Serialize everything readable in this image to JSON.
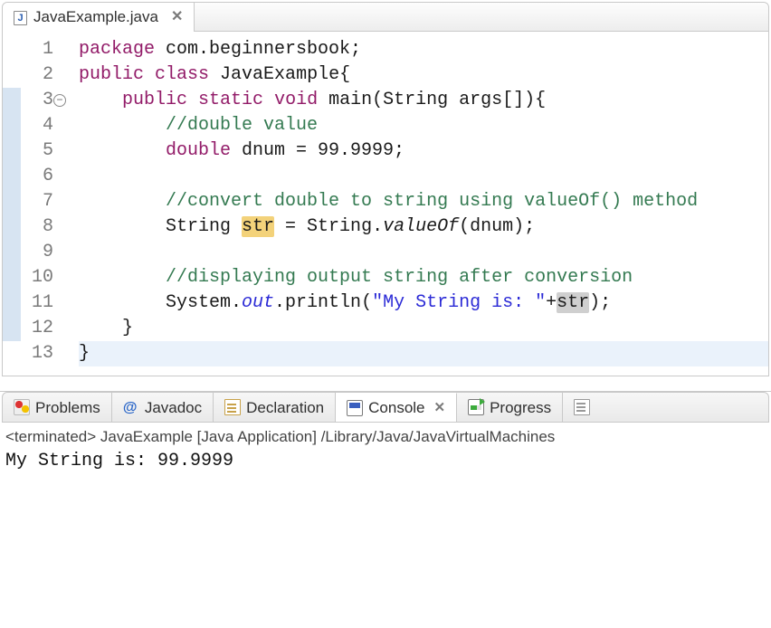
{
  "editor": {
    "tab": {
      "filename": "JavaExample.java"
    },
    "gutter": [
      "1",
      "2",
      "3",
      "4",
      "5",
      "6",
      "7",
      "8",
      "9",
      "10",
      "11",
      "12",
      "13"
    ],
    "fold_line_index": 2,
    "bar_blue_lines": [
      2,
      3,
      4,
      5,
      6,
      7,
      8,
      9,
      10,
      11
    ],
    "current_line_index": 12,
    "lines": [
      [
        [
          "kw",
          "package"
        ],
        [
          "code",
          " com.beginnersbook;"
        ]
      ],
      [
        [
          "kw",
          "public"
        ],
        [
          "code",
          " "
        ],
        [
          "kw",
          "class"
        ],
        [
          "code",
          " JavaExample{"
        ]
      ],
      [
        [
          "code",
          "    "
        ],
        [
          "kw",
          "public"
        ],
        [
          "code",
          " "
        ],
        [
          "kw",
          "static"
        ],
        [
          "code",
          " "
        ],
        [
          "kw",
          "void"
        ],
        [
          "code",
          " main(String args[]){"
        ]
      ],
      [
        [
          "code",
          "        "
        ],
        [
          "com",
          "//double value"
        ]
      ],
      [
        [
          "code",
          "        "
        ],
        [
          "kw",
          "double"
        ],
        [
          "code",
          " dnum = 99.9999;"
        ]
      ],
      [
        [
          "code",
          ""
        ]
      ],
      [
        [
          "code",
          "        "
        ],
        [
          "com",
          "//convert double to string using valueOf() method"
        ]
      ],
      [
        [
          "code",
          "        String "
        ],
        [
          "hl-y",
          "str"
        ],
        [
          "code",
          " = String."
        ],
        [
          "mtd",
          "valueOf"
        ],
        [
          "code",
          "(dnum);"
        ]
      ],
      [
        [
          "code",
          ""
        ]
      ],
      [
        [
          "code",
          "        "
        ],
        [
          "com",
          "//displaying output string after conversion"
        ]
      ],
      [
        [
          "code",
          "        System."
        ],
        [
          "fld",
          "out"
        ],
        [
          "code",
          ".println("
        ],
        [
          "str",
          "\"My String is: \""
        ],
        [
          "code",
          "+"
        ],
        [
          "hl-g",
          "str"
        ],
        [
          "code",
          ");"
        ]
      ],
      [
        [
          "code",
          "    }"
        ]
      ],
      [
        [
          "code",
          "}"
        ]
      ]
    ]
  },
  "views": {
    "tabs": {
      "problems": "Problems",
      "javadoc": "Javadoc",
      "declaration": "Declaration",
      "console": "Console",
      "progress": "Progress"
    },
    "active": "console"
  },
  "console": {
    "status": "<terminated> JavaExample [Java Application] /Library/Java/JavaVirtualMachines",
    "output": "My String is: 99.9999"
  }
}
